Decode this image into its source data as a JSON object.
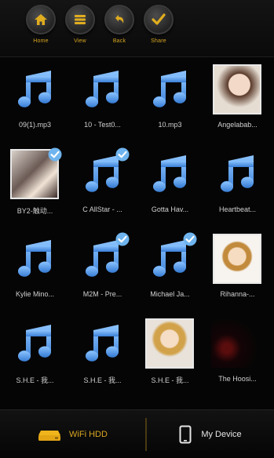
{
  "toolbar": {
    "items": [
      {
        "label": "Home",
        "icon": "home-icon"
      },
      {
        "label": "View",
        "icon": "list-icon"
      },
      {
        "label": "Back",
        "icon": "back-icon"
      },
      {
        "label": "Share",
        "icon": "check-icon"
      }
    ]
  },
  "grid": {
    "items": [
      {
        "name": "09(1).mp3",
        "type": "music",
        "checked": false
      },
      {
        "name": "10 - Test0...",
        "type": "music",
        "checked": false
      },
      {
        "name": "10.mp3",
        "type": "music",
        "checked": false
      },
      {
        "name": "Angelabab...",
        "type": "photo",
        "checked": false
      },
      {
        "name": "BY2-触动...",
        "type": "photo",
        "checked": true
      },
      {
        "name": "C AllStar - ...",
        "type": "music",
        "checked": true
      },
      {
        "name": "Gotta Hav...",
        "type": "music",
        "checked": false
      },
      {
        "name": "Heartbeat...",
        "type": "music",
        "checked": false
      },
      {
        "name": "Kylie Mino...",
        "type": "music",
        "checked": false
      },
      {
        "name": "M2M - Pre...",
        "type": "music",
        "checked": true
      },
      {
        "name": "Michael Ja...",
        "type": "music",
        "checked": true
      },
      {
        "name": "Rihanna-...",
        "type": "photo",
        "checked": false
      },
      {
        "name": "S.H.E - 我...",
        "type": "music",
        "checked": false
      },
      {
        "name": "S.H.E - 我...",
        "type": "music",
        "checked": false
      },
      {
        "name": "S.H.E - 我...",
        "type": "photo",
        "checked": false
      },
      {
        "name": "The Hoosi...",
        "type": "dark",
        "checked": false
      }
    ]
  },
  "bottom": {
    "wifi_label": "WiFi HDD",
    "device_label": "My Device"
  },
  "colors": {
    "accent": "#d7a520",
    "note": "#5b9ee8",
    "check": "#6fb4ee"
  }
}
